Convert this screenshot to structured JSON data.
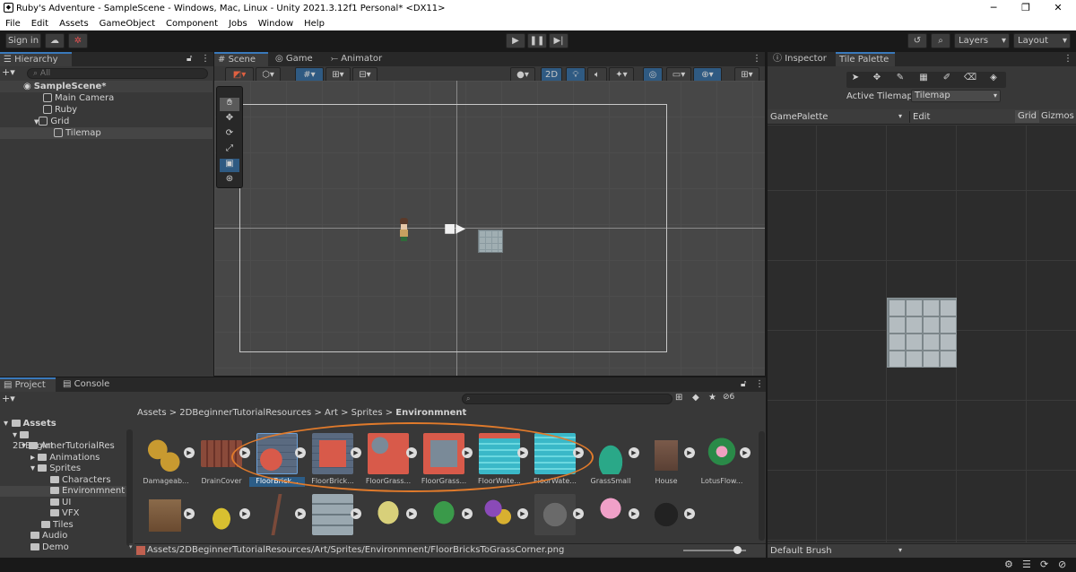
{
  "window": {
    "title": "Ruby's Adventure - SampleScene - Windows, Mac, Linux - Unity 2021.3.12f1 Personal* <DX11>"
  },
  "menu": [
    "File",
    "Edit",
    "Assets",
    "GameObject",
    "Component",
    "Jobs",
    "Window",
    "Help"
  ],
  "toolbar": {
    "sign_in": "Sign in",
    "layers": "Layers",
    "layout": "Layout"
  },
  "hierarchy": {
    "tab": "Hierarchy",
    "search_placeholder": "All",
    "scene": "SampleScene*",
    "items": [
      "Main Camera",
      "Ruby",
      "Grid",
      "Tilemap"
    ]
  },
  "scene_tabs": [
    "Scene",
    "Game",
    "Animator"
  ],
  "scene_toolbar": {
    "mode_2d": "2D"
  },
  "inspector": {
    "tab_inspector": "Inspector",
    "tab_palette": "Tile Palette",
    "active_tilemap_label": "Active Tilemap",
    "active_tilemap_value": "Tilemap",
    "palette_name": "GamePalette",
    "edit": "Edit",
    "grid": "Grid",
    "gizmos": "Gizmos",
    "brush": "Default Brush"
  },
  "project": {
    "tab_project": "Project",
    "tab_console": "Console",
    "badge": "6",
    "breadcrumb": [
      "Assets",
      "2DBeginnerTutorialResources",
      "Art",
      "Sprites",
      "Environmnent"
    ],
    "tree": [
      "Assets",
      "2DBeginnerTutorialRes",
      "Art",
      "Animations",
      "Sprites",
      "Characters",
      "Environmnent",
      "UI",
      "VFX",
      "Tiles",
      "Audio",
      "Demo"
    ],
    "assets_row1": [
      "Damageab...",
      "DrainCover",
      "FloorBrick...",
      "FloorBrick...",
      "FloorGrass...",
      "FloorGrass...",
      "FloorWate...",
      "FloorWate...",
      "GrassSmall",
      "House",
      "LotusFlow..."
    ],
    "status_path": "Assets/2DBeginnerTutorialResources/Art/Sprites/Environmnent/FloorBricksToGrassCorner.png"
  },
  "colors": {
    "accent": "#3a79bb",
    "highlight": "#e07a2b",
    "selection": "#2c5d87"
  }
}
